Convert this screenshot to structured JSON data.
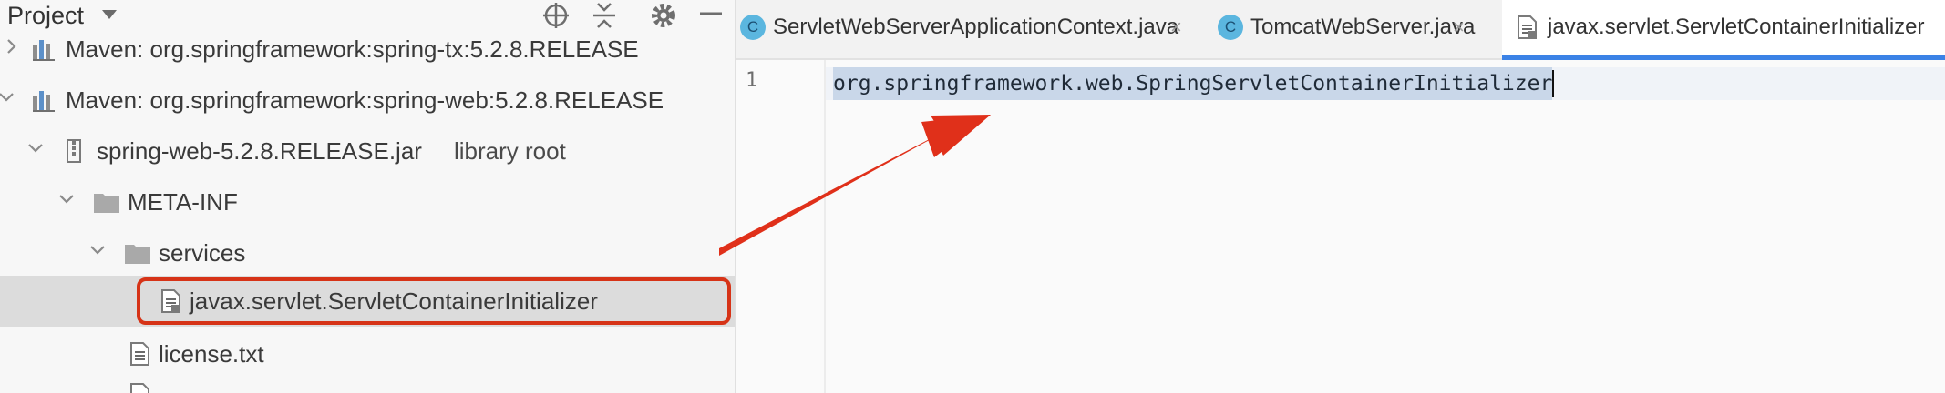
{
  "project_panel": {
    "title": "Project",
    "header_icons": [
      "crosshair-icon",
      "collapse-all-icon",
      "gear-icon",
      "minimize-icon"
    ],
    "tree": [
      {
        "label": "Maven: org.springframework:spring-tx:5.2.8.RELEASE",
        "icon": "library-icon",
        "expanded": false
      },
      {
        "label": "Maven: org.springframework:spring-web:5.2.8.RELEASE",
        "icon": "library-icon",
        "expanded": true
      },
      {
        "label": "spring-web-5.2.8.RELEASE.jar",
        "sublabel": "library root",
        "icon": "jar-icon",
        "expanded": true
      },
      {
        "label": "META-INF",
        "icon": "folder-icon",
        "expanded": true
      },
      {
        "label": "services",
        "icon": "folder-icon",
        "expanded": true
      },
      {
        "label": "javax.servlet.ServletContainerInitializer",
        "icon": "file-icon",
        "selected": true
      },
      {
        "label": "license.txt",
        "icon": "text-file-icon"
      }
    ]
  },
  "editor": {
    "tabs": [
      {
        "label": "ServletWebServerApplicationContext.java",
        "icon": "class-icon",
        "icon_letter": "C",
        "active": false
      },
      {
        "label": "TomcatWebServer.java",
        "icon": "class-icon",
        "icon_letter": "C",
        "active": false
      },
      {
        "label": "javax.servlet.ServletContainerInitializer",
        "icon": "file-icon",
        "active": true
      }
    ],
    "close_glyph": "×",
    "lines": [
      {
        "number": "1",
        "text": "org.springframework.web.SpringServletContainerInitializer"
      }
    ]
  },
  "colors": {
    "highlight_box": "#d63317",
    "arrow": "#e0301a",
    "active_tab_underline": "#3b82e6",
    "selection": "#c9d7e9"
  }
}
